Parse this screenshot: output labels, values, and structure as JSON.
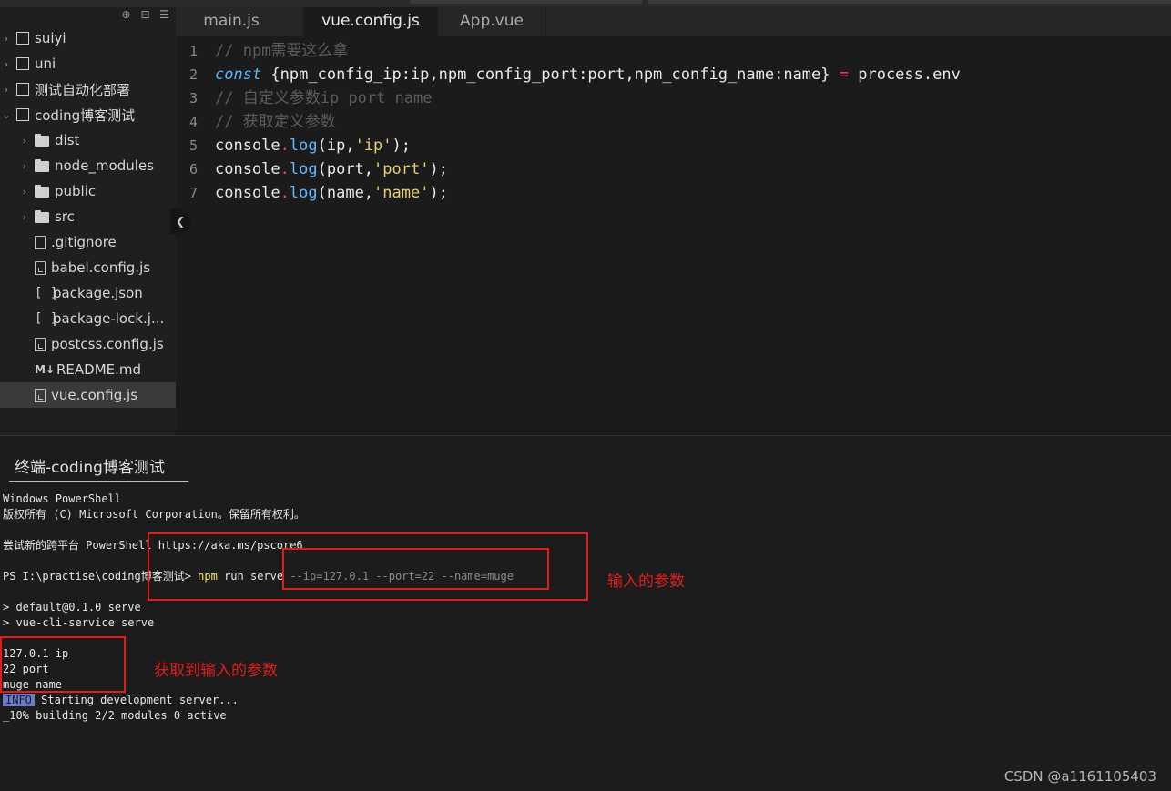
{
  "sidebar": {
    "toolbar_icons": [
      "target-icon",
      "collapse-all-icon",
      "menu-icon"
    ],
    "items": [
      {
        "label": "suiyi",
        "type": "box",
        "chevron": "›"
      },
      {
        "label": "uni",
        "type": "box",
        "chevron": "›"
      },
      {
        "label": "测试自动化部署",
        "type": "box",
        "chevron": "›"
      },
      {
        "label": "coding博客测试",
        "type": "box",
        "chevron": "⌄"
      },
      {
        "label": "dist",
        "type": "folder",
        "chevron": "›"
      },
      {
        "label": "node_modules",
        "type": "folder",
        "chevron": "›"
      },
      {
        "label": "public",
        "type": "folder",
        "chevron": "›"
      },
      {
        "label": "src",
        "type": "folder",
        "chevron": "›"
      },
      {
        "label": ".gitignore",
        "type": "file"
      },
      {
        "label": "babel.config.js",
        "type": "js"
      },
      {
        "label": "package.json",
        "type": "json"
      },
      {
        "label": "package-lock.j...",
        "type": "json"
      },
      {
        "label": "postcss.config.js",
        "type": "js"
      },
      {
        "label": "README.md",
        "type": "md"
      },
      {
        "label": "vue.config.js",
        "type": "js",
        "selected": true
      }
    ]
  },
  "tabs": [
    {
      "label": "main.js",
      "active": false
    },
    {
      "label": "vue.config.js",
      "active": true
    },
    {
      "label": "App.vue",
      "active": false
    }
  ],
  "editor": {
    "line_numbers": [
      "1",
      "2",
      "3",
      "4",
      "5",
      "6",
      "7"
    ],
    "line1": "// npm需要这么拿",
    "line2": {
      "kw": "const",
      "body": " {npm_config_ip:ip,npm_config_port:port,npm_config_name:name} ",
      "op": "=",
      "rhs": " process.env"
    },
    "line3": "// 自定义参数ip port name",
    "line4": "// 获取定义参数",
    "line5": {
      "obj": "console",
      "dot": ".",
      "fn": "log",
      "open": "(ip,",
      "str": "'ip'",
      "close": ");"
    },
    "line6": {
      "obj": "console",
      "dot": ".",
      "fn": "log",
      "open": "(port,",
      "str": "'port'",
      "close": ");"
    },
    "line7": {
      "obj": "console",
      "dot": ".",
      "fn": "log",
      "open": "(name,",
      "str": "'name'",
      "close": ");"
    }
  },
  "terminal": {
    "title": "终端-coding博客测试",
    "l1": "Windows PowerShell",
    "l2": "版权所有 (C) Microsoft Corporation。保留所有权利。",
    "l3": "尝试新的跨平台 PowerShell https://aka.ms/pscore6",
    "prompt": "PS I:\\practise\\coding博客测试> ",
    "cmd": "npm",
    "cmd_rest": " run serve ",
    "args": "--ip=127.0.1 --port=22 --name=muge",
    "l5": "> default@0.1.0 serve",
    "l6": "> vue-cli-service serve",
    "l7": "127.0.1 ip",
    "l8": "22 port",
    "l9": "muge name",
    "info_badge": "INFO",
    "l10": " Starting development server...",
    "l11": "_10% building 2/2 modules 0 active"
  },
  "annotations": {
    "input_params": "输入的参数",
    "got_params": "获取到输入的参数"
  },
  "watermark": "CSDN @a1161105403",
  "colors": {
    "accent_red": "#e01c1c",
    "string": "#e6d06a",
    "keyword": "#4fb4ff",
    "operator": "#ff3b7a"
  }
}
